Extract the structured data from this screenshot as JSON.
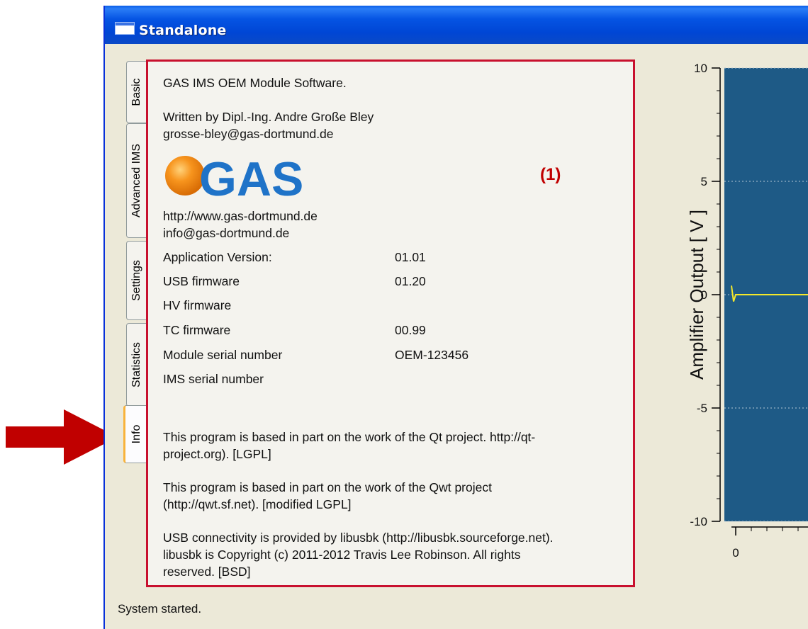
{
  "window": {
    "title": "Standalone"
  },
  "tabs": [
    {
      "label": "Basic"
    },
    {
      "label": "Advanced IMS"
    },
    {
      "label": "Settings"
    },
    {
      "label": "Statistics"
    },
    {
      "label": "Info"
    }
  ],
  "info": {
    "header": "GAS IMS OEM Module Software.",
    "author": "Written by Dipl.-Ing. Andre Große Bley",
    "author_email": "grosse-bley@gas-dortmund.de",
    "logo_text": "GAS",
    "website": "http://www.gas-dortmund.de",
    "contact_email": "info@gas-dortmund.de",
    "details": [
      {
        "label": "Application Version:",
        "value": "01.01"
      },
      {
        "label": "USB firmware",
        "value": "01.20"
      },
      {
        "label": "HV firmware",
        "value": ""
      },
      {
        "label": "TC firmware",
        "value": "00.99"
      },
      {
        "label": "Module serial number",
        "value": "OEM-123456"
      },
      {
        "label": "IMS serial number",
        "value": ""
      }
    ],
    "credits": {
      "qt_line1": "This program is based in part on the work of the Qt project.  http://qt-",
      "qt_line2": "project.org). [LGPL]",
      "qwt_line1": "This program is based in part on the work of the Qwt project",
      "qwt_line2": "(http://qwt.sf.net). [modified LGPL]",
      "usb_line1": "USB connectivity is provided by libusbk (http://libusbk.sourceforge.net).",
      "usb_line2": "libusbk is Copyright (c) 2011-2012 Travis Lee Robinson. All rights",
      "usb_line3": "reserved. [BSD]"
    }
  },
  "annotation": {
    "label": "(1)",
    "color": "#c00000"
  },
  "status": {
    "text": "System started."
  },
  "plot": {
    "ylabel": "Amplifier Output [ V ]",
    "yticks": [
      "10",
      "5",
      "0",
      "-5",
      "-10"
    ],
    "xticks": [
      "0"
    ],
    "background": "#1e5a86",
    "trace_color": "#f5e82a"
  },
  "chart_data": {
    "type": "line",
    "ylabel": "Amplifier Output [ V ]",
    "ylim": [
      -10,
      10
    ],
    "yticks": [
      10,
      5,
      0,
      -5,
      -10
    ],
    "xticks": [
      0
    ],
    "grid": true,
    "series": [
      {
        "values": [
          0.4,
          -0.3,
          0,
          0,
          0,
          0,
          0,
          0,
          0
        ]
      }
    ]
  },
  "colors": {
    "titlebar": "#0054e3",
    "window_face": "#ece9d8",
    "annotation_border": "#c8102e",
    "logo_orange": "#f7941d",
    "logo_blue": "#1f73c8",
    "arrow": "#c00000"
  }
}
